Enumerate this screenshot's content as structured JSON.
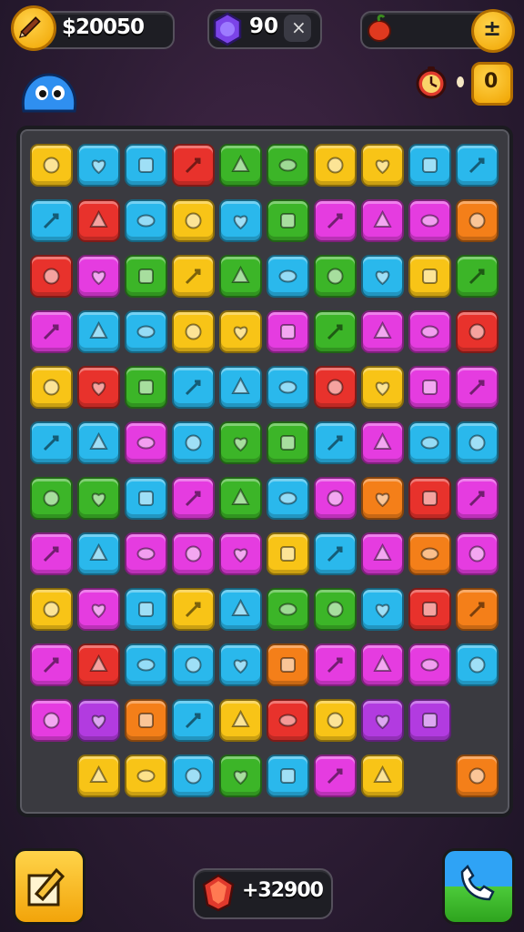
{
  "hud": {
    "coins_value": "$20050",
    "gems_value": "90",
    "gems_close_symbol": "×",
    "health_symbol": "±",
    "timer_value": "0",
    "bottom_counter_value": "+32900"
  },
  "icons": {
    "coins": "pencil-coin-icon",
    "gems": "purple-gem-icon",
    "health": "apple-icon",
    "mascot": "blue-slime-mascot-icon",
    "timer": "clock-icon",
    "edit": "pencil-edit-icon",
    "call": "phone-icon",
    "bottom_counter": "red-gem-icon"
  },
  "colors": {
    "yellow": "#f8c417",
    "cyan": "#2ab8ec",
    "purple": "#b23be0",
    "red": "#e8322c",
    "green": "#3cb528",
    "pink": "#e53ce0",
    "orange": "#f47f19"
  },
  "board": {
    "rows": [
      [
        "yellow",
        "cyan",
        "cyan",
        "red",
        "green",
        "green",
        "yellow",
        "yellow",
        "cyan",
        "cyan"
      ],
      [
        "cyan",
        "red",
        "cyan",
        "yellow",
        "cyan",
        "green",
        "pink",
        "pink",
        "pink",
        "orange"
      ],
      [
        "red",
        "pink",
        "green",
        "yellow",
        "green",
        "cyan",
        "green",
        "cyan",
        "yellow",
        "green"
      ],
      [
        "pink",
        "cyan",
        "cyan",
        "yellow",
        "yellow",
        "pink",
        "green",
        "pink",
        "pink",
        "red"
      ],
      [
        "yellow",
        "red",
        "green",
        "cyan",
        "cyan",
        "cyan",
        "red",
        "yellow",
        "pink",
        "pink"
      ],
      [
        "cyan",
        "cyan",
        "pink",
        "cyan",
        "green",
        "green",
        "cyan",
        "pink",
        "cyan",
        "cyan"
      ],
      [
        "green",
        "green",
        "cyan",
        "pink",
        "green",
        "cyan",
        "pink",
        "orange",
        "red",
        "pink"
      ],
      [
        "pink",
        "cyan",
        "pink",
        "pink",
        "pink",
        "yellow",
        "cyan",
        "pink",
        "orange",
        "pink"
      ],
      [
        "yellow",
        "pink",
        "cyan",
        "yellow",
        "cyan",
        "green",
        "green",
        "cyan",
        "red",
        "orange"
      ],
      [
        "pink",
        "red",
        "cyan",
        "cyan",
        "cyan",
        "orange",
        "pink",
        "pink",
        "pink",
        "cyan"
      ],
      [
        "pink",
        "purple",
        "orange",
        "cyan",
        "yellow",
        "red",
        "yellow",
        "purple",
        "purple",
        ""
      ],
      [
        "",
        "yellow",
        "yellow",
        "cyan",
        "green",
        "cyan",
        "pink",
        "yellow",
        "",
        "orange"
      ]
    ]
  }
}
